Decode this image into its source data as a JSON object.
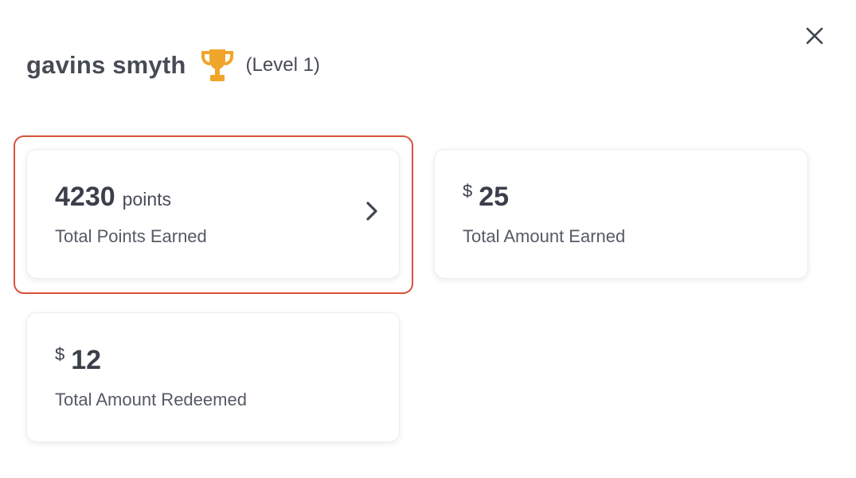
{
  "user": {
    "name": "gavins smyth",
    "level": "(Level 1)",
    "badge_icon": "trophy-icon",
    "badge_color": "#f0a52b"
  },
  "close_icon": "close-icon",
  "cards": {
    "points": {
      "value": "4230",
      "unit": "points",
      "label": "Total Points Earned",
      "action_icon": "chevron-right-icon"
    },
    "earned": {
      "currency": "$",
      "value": "25",
      "label": "Total Amount Earned"
    },
    "redeemed": {
      "currency": "$",
      "value": "12",
      "label": "Total Amount Redeemed"
    }
  },
  "colors": {
    "highlight": "#d9533b",
    "text_primary": "#3a3f4a",
    "text_secondary": "#555a64"
  }
}
